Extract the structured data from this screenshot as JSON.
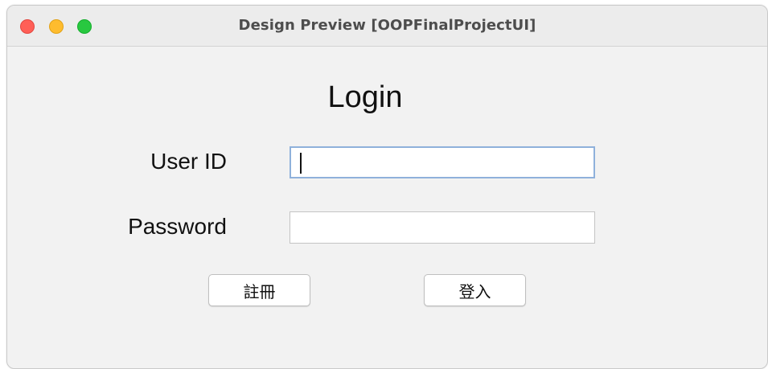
{
  "window": {
    "title": "Design Preview [OOPFinalProjectUI]"
  },
  "form": {
    "heading": "Login",
    "user_id_label": "User ID",
    "user_id_value": "",
    "password_label": "Password",
    "password_value": "",
    "register_button": "註冊",
    "login_button": "登入"
  },
  "colors": {
    "close": "#ff5f57",
    "minimize": "#febc2e",
    "zoom": "#28c840",
    "focus_ring": "#8fb1db",
    "window_bg": "#f2f2f2"
  }
}
